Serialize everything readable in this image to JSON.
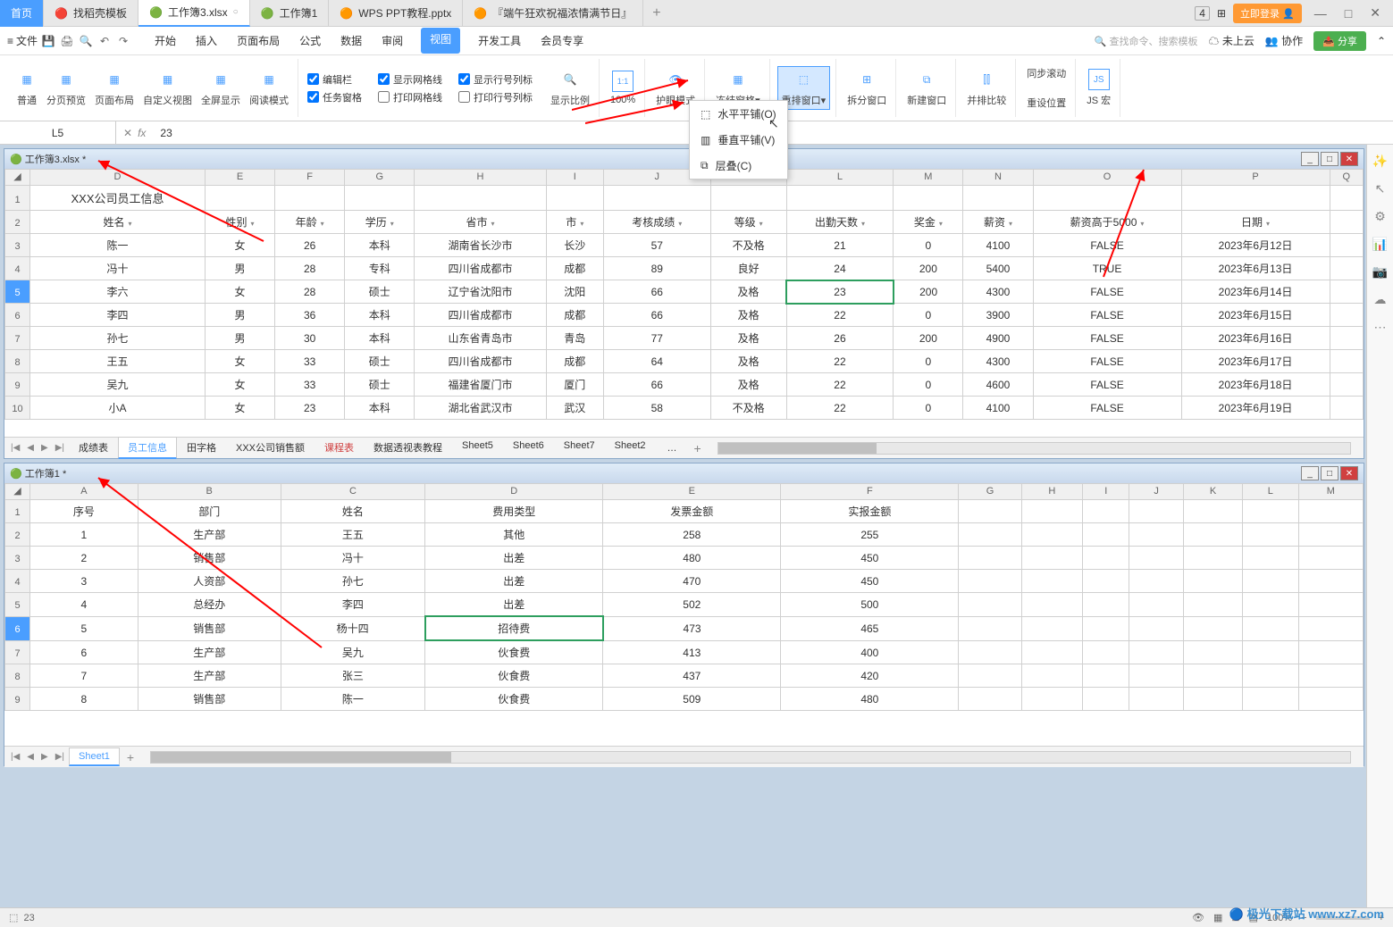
{
  "titlebar": {
    "home": "首页",
    "tabs": [
      {
        "icon": "🔴",
        "label": "找稻壳模板"
      },
      {
        "icon": "🟢",
        "label": "工作簿3.xlsx",
        "active": true
      },
      {
        "icon": "🟢",
        "label": "工作簿1"
      },
      {
        "icon": "🟠",
        "label": "WPS PPT教程.pptx"
      },
      {
        "icon": "🟠",
        "label": "『端午狂欢祝福浓情满节日』"
      }
    ],
    "badge": "4",
    "login": "立即登录"
  },
  "menubar": {
    "file": "文件",
    "tabs": [
      "开始",
      "插入",
      "页面布局",
      "公式",
      "数据",
      "审阅",
      "视图",
      "开发工具",
      "会员专享"
    ],
    "active": "视图",
    "search": "查找命令、搜索模板",
    "cloud": "未上云",
    "collab": "协作",
    "share": "分享"
  },
  "ribbon": {
    "views": [
      {
        "label": "普通"
      },
      {
        "label": "分页预览"
      },
      {
        "label": "页面布局"
      },
      {
        "label": "自定义视图"
      },
      {
        "label": "全屏显示"
      },
      {
        "label": "阅读模式"
      }
    ],
    "checks": [
      {
        "label": "编辑栏",
        "checked": true
      },
      {
        "label": "任务窗格",
        "checked": true
      },
      {
        "label": "显示网格线",
        "checked": true
      },
      {
        "label": "打印网格线",
        "checked": false
      },
      {
        "label": "显示行号列标",
        "checked": true
      },
      {
        "label": "打印行号列标",
        "checked": false
      }
    ],
    "zoom": {
      "label": "显示比例"
    },
    "zoom100": {
      "label": "100%"
    },
    "eye": {
      "label": "护眼模式"
    },
    "freeze": {
      "label": "冻结窗格"
    },
    "arrange": {
      "label": "重排窗口"
    },
    "split": {
      "label": "拆分窗口"
    },
    "newwin": {
      "label": "新建窗口"
    },
    "compare": {
      "label": "并排比较"
    },
    "sync": {
      "label": "同步滚动"
    },
    "reset": {
      "label": "重设位置"
    },
    "jsmacro": {
      "label": "JS 宏"
    }
  },
  "dropdown": {
    "items": [
      {
        "label": "水平平铺(O)"
      },
      {
        "label": "垂直平铺(V)"
      },
      {
        "label": "层叠(C)"
      }
    ]
  },
  "formula": {
    "namebox": "L5",
    "value": "23"
  },
  "wb1": {
    "title": "工作簿3.xlsx *",
    "cols": [
      "D",
      "E",
      "F",
      "G",
      "H",
      "I",
      "J",
      "K",
      "L",
      "M",
      "N",
      "O",
      "P",
      "Q"
    ],
    "mergedTitle": "XXX公司员工信息",
    "headers": [
      "姓名",
      "性别",
      "年龄",
      "学历",
      "省市",
      "市",
      "考核成绩",
      "等级",
      "出勤天数",
      "奖金",
      "薪资",
      "薪资高于5000",
      "日期"
    ],
    "rows": [
      {
        "n": 3,
        "d": [
          "陈一",
          "女",
          "26",
          "本科",
          "湖南省长沙市",
          "长沙",
          "57",
          "不及格",
          "21",
          "0",
          "4100",
          "FALSE",
          "2023年6月12日"
        ]
      },
      {
        "n": 4,
        "d": [
          "冯十",
          "男",
          "28",
          "专科",
          "四川省成都市",
          "成都",
          "89",
          "良好",
          "24",
          "200",
          "5400",
          "TRUE",
          "2023年6月13日"
        ]
      },
      {
        "n": 5,
        "d": [
          "李六",
          "女",
          "28",
          "硕士",
          "辽宁省沈阳市",
          "沈阳",
          "66",
          "及格",
          "23",
          "200",
          "4300",
          "FALSE",
          "2023年6月14日"
        ],
        "sel": true
      },
      {
        "n": 6,
        "d": [
          "李四",
          "男",
          "36",
          "本科",
          "四川省成都市",
          "成都",
          "66",
          "及格",
          "22",
          "0",
          "3900",
          "FALSE",
          "2023年6月15日"
        ]
      },
      {
        "n": 7,
        "d": [
          "孙七",
          "男",
          "30",
          "本科",
          "山东省青岛市",
          "青岛",
          "77",
          "及格",
          "26",
          "200",
          "4900",
          "FALSE",
          "2023年6月16日"
        ]
      },
      {
        "n": 8,
        "d": [
          "王五",
          "女",
          "33",
          "硕士",
          "四川省成都市",
          "成都",
          "64",
          "及格",
          "22",
          "0",
          "4300",
          "FALSE",
          "2023年6月17日"
        ]
      },
      {
        "n": 9,
        "d": [
          "吴九",
          "女",
          "33",
          "硕士",
          "福建省厦门市",
          "厦门",
          "66",
          "及格",
          "22",
          "0",
          "4600",
          "FALSE",
          "2023年6月18日"
        ]
      },
      {
        "n": 10,
        "d": [
          "小A",
          "女",
          "23",
          "本科",
          "湖北省武汉市",
          "武汉",
          "58",
          "不及格",
          "22",
          "0",
          "4100",
          "FALSE",
          "2023年6月19日"
        ]
      }
    ],
    "sheets": [
      "成绩表",
      "员工信息",
      "田字格",
      "XXX公司销售额",
      "课程表",
      "数据透视表教程",
      "Sheet5",
      "Sheet6",
      "Sheet7",
      "Sheet2"
    ],
    "activeSheet": "员工信息",
    "redSheet": "课程表",
    "more": "…"
  },
  "wb2": {
    "title": "工作簿1 *",
    "cols": [
      "A",
      "B",
      "C",
      "D",
      "E",
      "F",
      "G",
      "H",
      "I",
      "J",
      "K",
      "L",
      "M"
    ],
    "headers": [
      "序号",
      "部门",
      "姓名",
      "费用类型",
      "发票金额",
      "实报金额"
    ],
    "rows": [
      {
        "n": 2,
        "d": [
          "1",
          "生产部",
          "王五",
          "其他",
          "258",
          "255"
        ]
      },
      {
        "n": 3,
        "d": [
          "2",
          "销售部",
          "冯十",
          "出差",
          "480",
          "450"
        ]
      },
      {
        "n": 4,
        "d": [
          "3",
          "人资部",
          "孙七",
          "出差",
          "470",
          "450"
        ]
      },
      {
        "n": 5,
        "d": [
          "4",
          "总经办",
          "李四",
          "出差",
          "502",
          "500"
        ]
      },
      {
        "n": 6,
        "d": [
          "5",
          "销售部",
          "杨十四",
          "招待费",
          "473",
          "465"
        ],
        "sel": true
      },
      {
        "n": 7,
        "d": [
          "6",
          "生产部",
          "吴九",
          "伙食费",
          "413",
          "400"
        ]
      },
      {
        "n": 8,
        "d": [
          "7",
          "生产部",
          "张三",
          "伙食费",
          "437",
          "420"
        ]
      },
      {
        "n": 9,
        "d": [
          "8",
          "销售部",
          "陈一",
          "伙食费",
          "509",
          "480"
        ]
      }
    ],
    "sheets": [
      "Sheet1"
    ],
    "activeSheet": "Sheet1"
  },
  "statusbar": {
    "value": "23",
    "zoom": "100%"
  },
  "watermark": "极光下载站 www.xz7.com"
}
